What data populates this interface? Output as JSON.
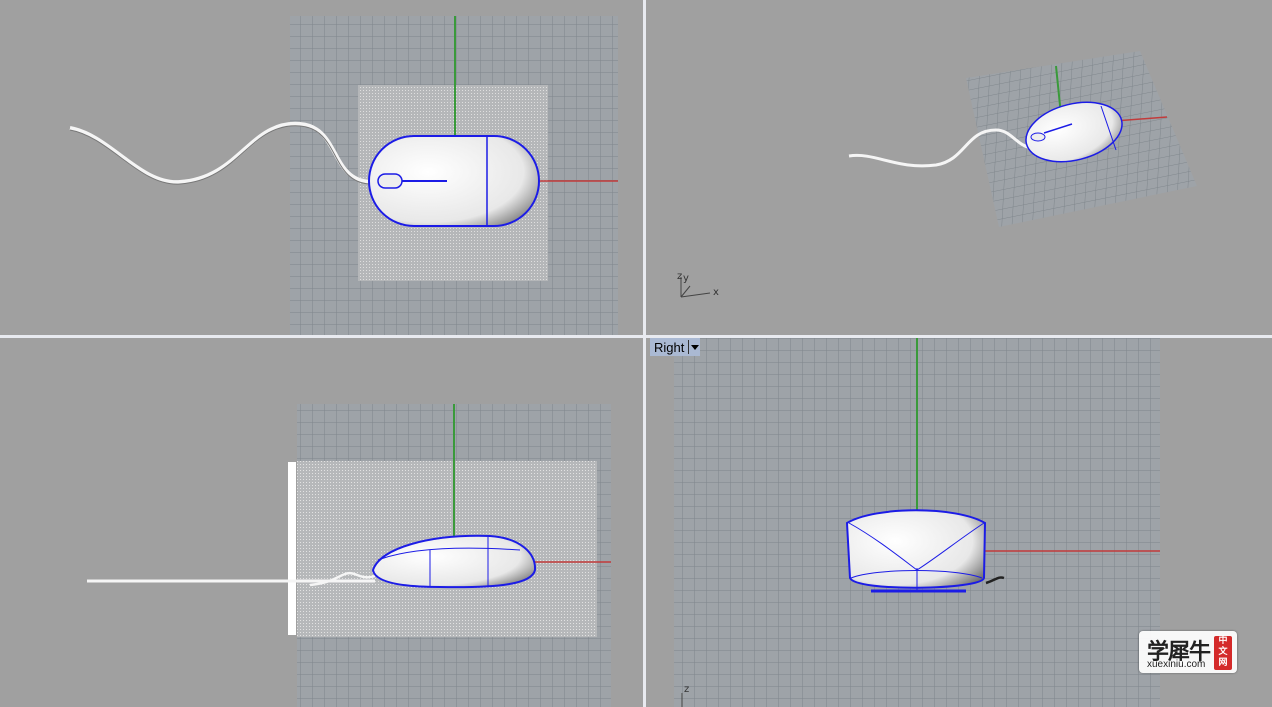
{
  "viewports": {
    "top": {
      "title": ""
    },
    "perspective": {
      "title": "",
      "axis_x": "x",
      "axis_y": "y",
      "axis_z": "z"
    },
    "front": {
      "title": ""
    },
    "right": {
      "title": "Right",
      "axis_z": "z"
    }
  },
  "colors": {
    "background": "#a0a0a0",
    "grid_line": "#8d9399",
    "axis_x": "#c23b3b",
    "axis_y": "#3a9a3a",
    "edge": "#1c1ce6",
    "surface": "#f2f2f2"
  },
  "watermark": {
    "chinese": "学犀牛",
    "seal": "中文网",
    "url": "xuexiniu.com"
  }
}
